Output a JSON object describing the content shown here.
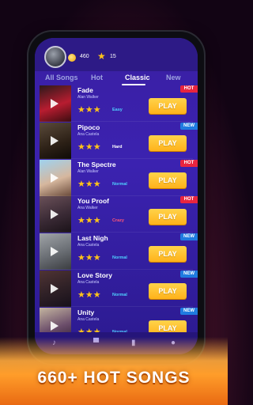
{
  "header": {
    "coins": "460",
    "stars": "15"
  },
  "tabs": [
    {
      "label": "All Songs"
    },
    {
      "label": "Hot"
    },
    {
      "label": "Classic"
    },
    {
      "label": "New"
    }
  ],
  "songs": [
    {
      "title": "Fade",
      "artist": "Alan Walker",
      "stars": 3,
      "difficulty": "Easy",
      "badge": "HOT",
      "button": "PLAY"
    },
    {
      "title": "Pipoco",
      "artist": "Ana Castela",
      "stars": 3,
      "difficulty": "Hard",
      "badge": "NEW",
      "button": "PLAY"
    },
    {
      "title": "The Spectre",
      "artist": "Alan Walker",
      "stars": 3,
      "difficulty": "Normal",
      "badge": "HOT",
      "button": "PLAY"
    },
    {
      "title": "You Proof",
      "artist": "Ana Walker",
      "stars": 3,
      "difficulty": "Crazy",
      "badge": "HOT",
      "button": "PLAY"
    },
    {
      "title": "Last Nigh",
      "artist": "Ana Castela",
      "stars": 3,
      "difficulty": "Normal",
      "badge": "NEW",
      "button": "PLAY"
    },
    {
      "title": "Love Story",
      "artist": "Ana Castela",
      "stars": 3,
      "difficulty": "Normal",
      "badge": "NEW",
      "button": "PLAY"
    },
    {
      "title": "Unity",
      "artist": "Ana Castela",
      "stars": 3,
      "difficulty": "Normal",
      "badge": "NEW",
      "button": "PLAY"
    }
  ],
  "colors": {
    "hot_badge": "#e8253f",
    "new_badge": "#1f7be0",
    "play_button": "#ffbd24",
    "Easy": "#4fd0ff",
    "Hard": "#ffffff",
    "Normal": "#4fd0ff",
    "Crazy": "#ff5577"
  },
  "banner": {
    "text": "660+ HOT SONGS"
  }
}
